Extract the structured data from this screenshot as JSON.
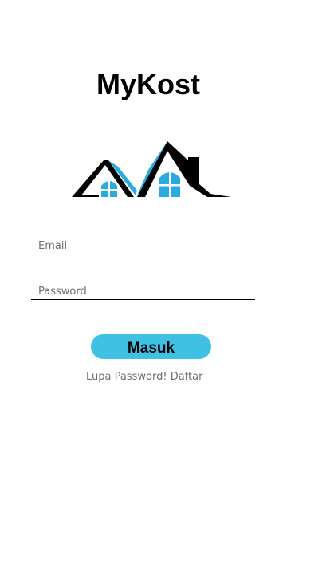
{
  "app": {
    "title": "MyKost"
  },
  "logo": {
    "icon": "house-roof-logo-icon",
    "colors": {
      "roof": "#000000",
      "accent": "#29abe2"
    }
  },
  "form": {
    "email_placeholder": "Email",
    "email_value": "",
    "password_placeholder": "Password",
    "password_value": "",
    "submit_label": "Masuk"
  },
  "links": {
    "forgot_password": "Lupa Password!",
    "register": "Daftar"
  },
  "colors": {
    "button": "#3fc1e3",
    "link_text": "#6f6f6f",
    "underline": "#000000"
  }
}
